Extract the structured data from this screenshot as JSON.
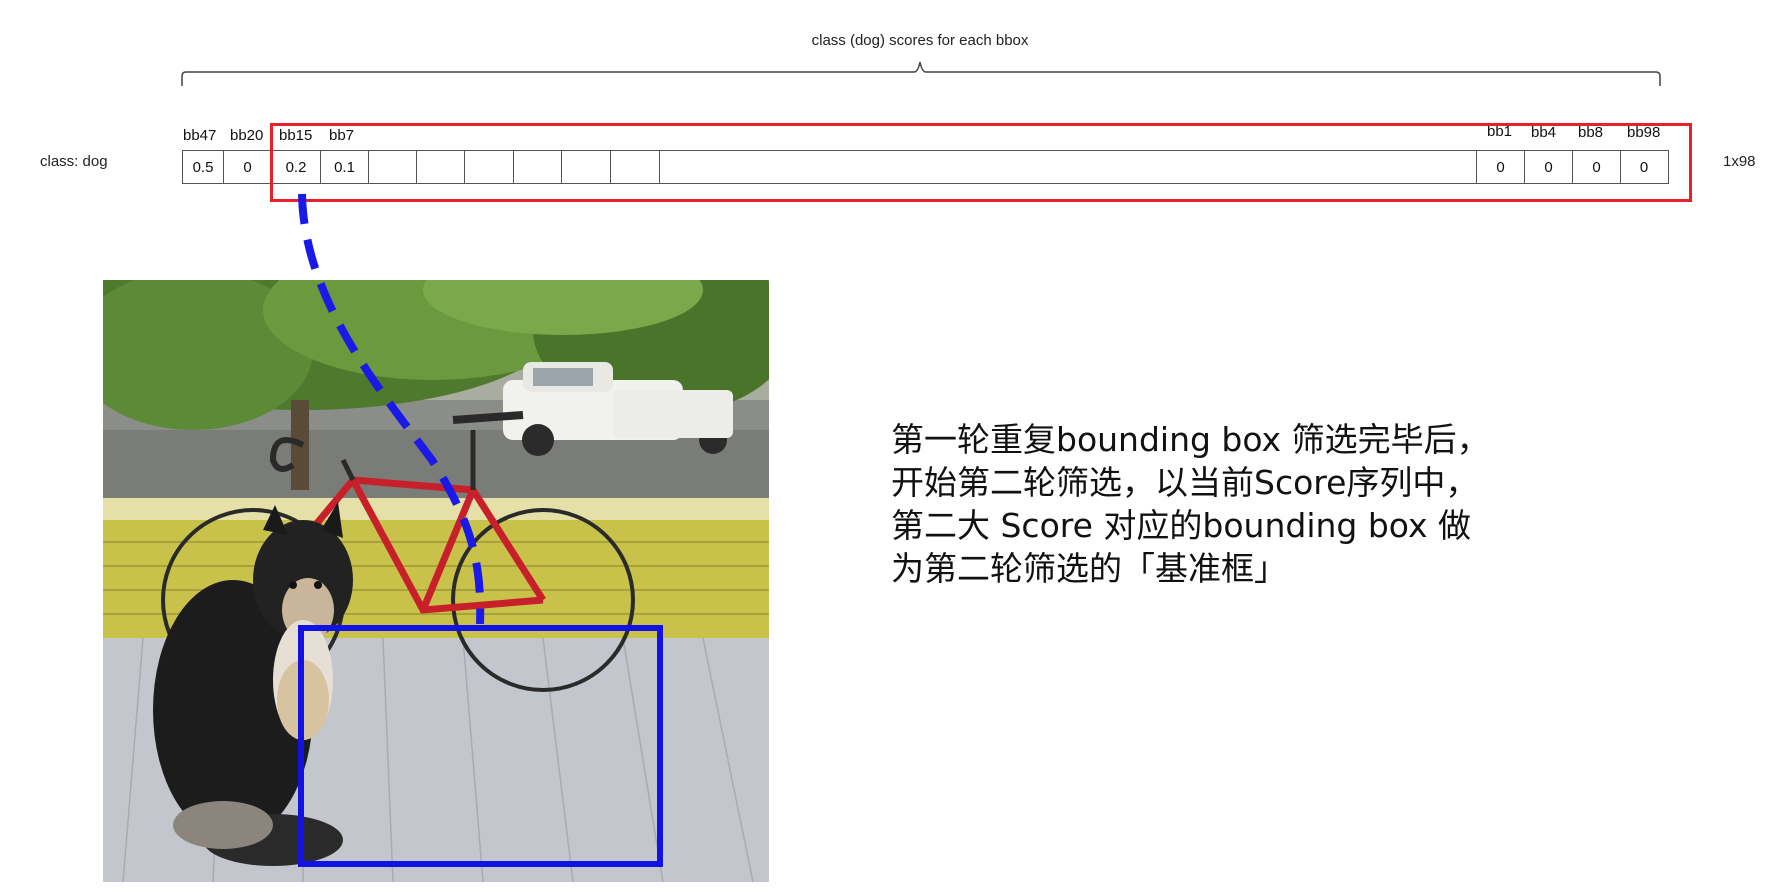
{
  "header": {
    "caption": "class (dog) scores for each bbox",
    "row_label": "class: dog",
    "dimensions": "1x98"
  },
  "bbox_labels": {
    "left": [
      "bb47",
      "bb20",
      "bb15",
      "bb7"
    ],
    "right": [
      "bb1",
      "bb4",
      "bb8",
      "bb98"
    ]
  },
  "scores": {
    "left": [
      "0.5",
      "0",
      "0.2",
      "0.1"
    ],
    "right": [
      "0",
      "0",
      "0",
      "0"
    ]
  },
  "explanation": {
    "lines": [
      "第一轮重复bounding box 筛选完毕后，",
      "开始第二轮筛选，以当前Score序列中，",
      "第二大 Score 对应的bounding box 做",
      "为第二轮筛选的「基准框」"
    ]
  },
  "colors": {
    "highlight": "#e8202a",
    "bbox_blue": "#1212e6",
    "leader_blue": "#1a1ae8"
  },
  "illustration": {
    "subject": "dog",
    "objects": [
      "dog",
      "bicycle",
      "car",
      "tree"
    ],
    "selected_bbox": "bb15"
  }
}
